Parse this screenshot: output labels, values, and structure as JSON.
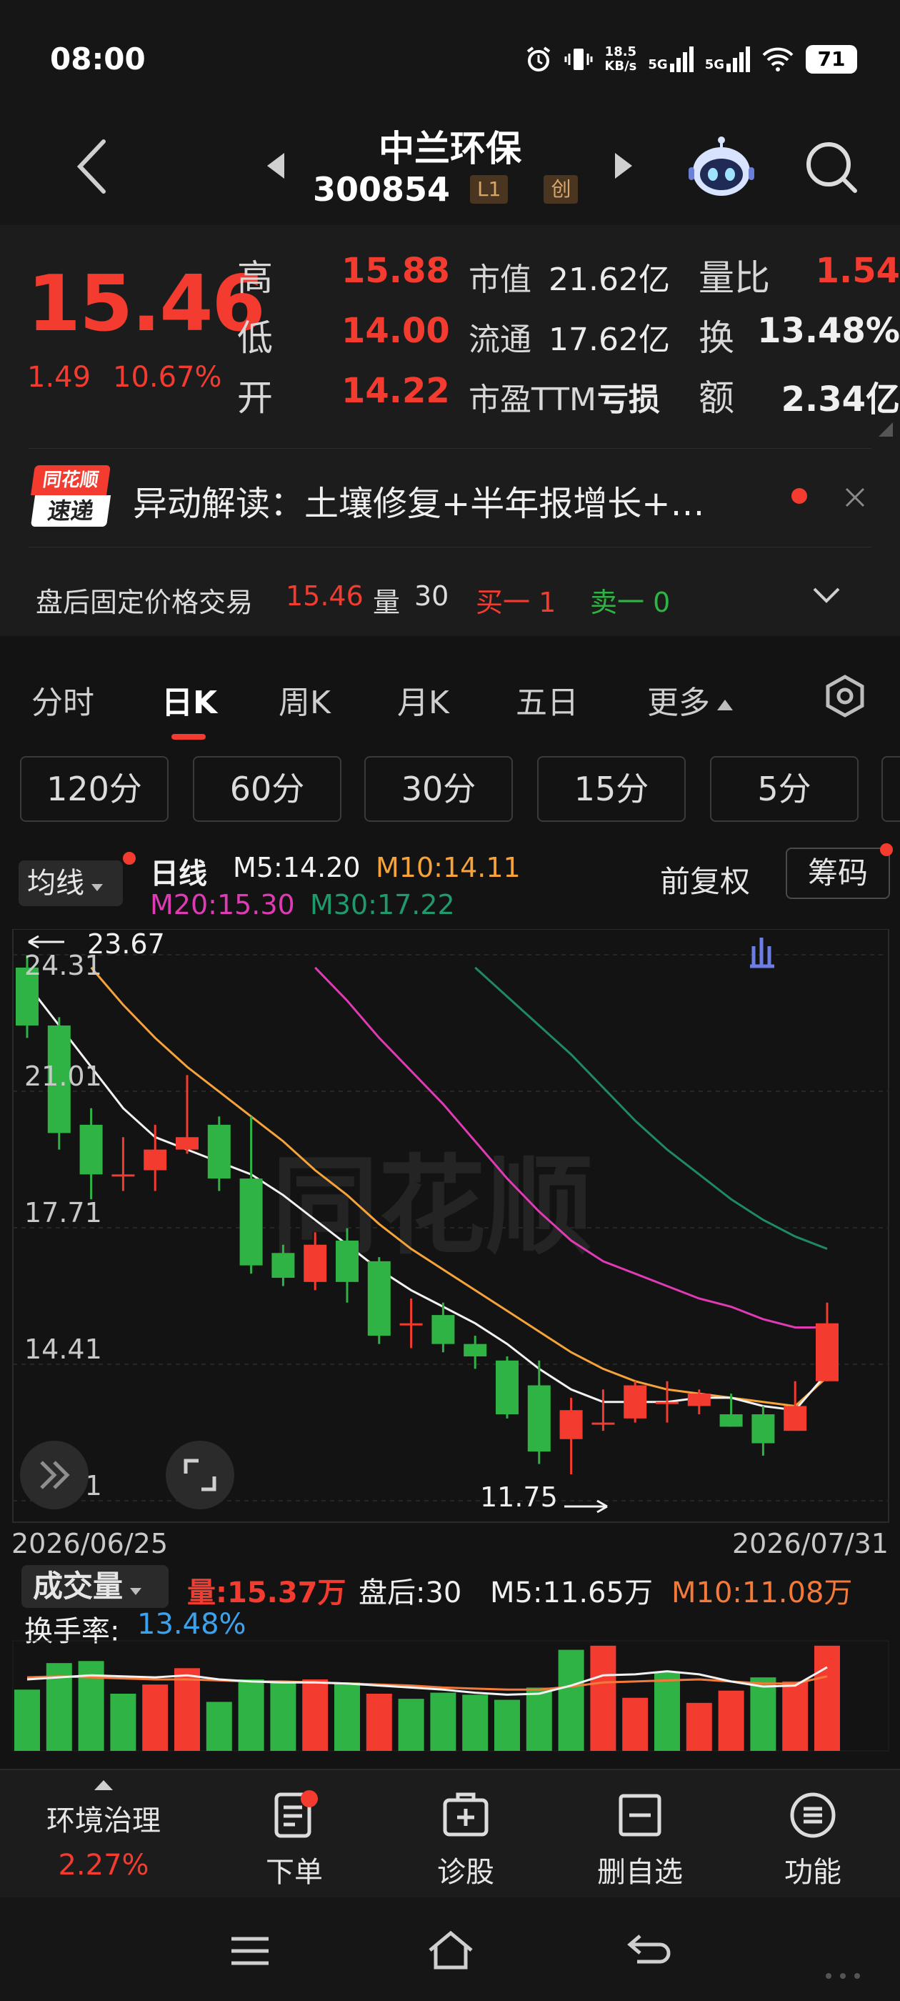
{
  "status": {
    "time": "08:00",
    "net_speed_top": "18.5",
    "net_speed_bottom": "KB/s",
    "signal1": "5G",
    "signal2": "5G",
    "battery": "71"
  },
  "header": {
    "name": "中兰环保",
    "code": "300854",
    "tag_l1": "L1",
    "tag_chuang": "创"
  },
  "quote": {
    "price": "15.46",
    "change_abs": "1.49",
    "change_pct": "10.67%",
    "high_label": "高",
    "high": "15.88",
    "low_label": "低",
    "low": "14.00",
    "open_label": "开",
    "open": "14.22",
    "mcap_label": "市值",
    "mcap": "21.62亿",
    "float_label": "流通",
    "float": "17.62亿",
    "pe_label": "市盈TTM",
    "pe": "亏损",
    "vr_label": "量比",
    "vr": "1.54",
    "turnover_label": "换",
    "turnover": "13.48%",
    "amount_label": "额",
    "amount": "2.34亿"
  },
  "news": {
    "brand_top": "同花顺",
    "brand_bottom": "速递",
    "text": "异动解读：土壤修复+半年报增长+…"
  },
  "after_hours": {
    "label": "盘后固定价格交易",
    "price": "15.46",
    "vol_label": "量",
    "vol": "30",
    "buy": "买一 1",
    "sell": "卖一 0"
  },
  "period_tabs": [
    "分时",
    "日K",
    "周K",
    "月K",
    "五日",
    "更多"
  ],
  "minute_tabs": [
    "120分",
    "60分",
    "30分",
    "15分",
    "5分"
  ],
  "ma": {
    "selector": "均线",
    "daily": "日线",
    "m5": "M5:14.20",
    "m10": "M10:14.11",
    "m20": "M20:15.30",
    "m30": "M30:17.22",
    "restore": "前复权",
    "chips": "筹码"
  },
  "chart_data": {
    "type": "candlestick",
    "y_ticks": [
      "24.31",
      "21.01",
      "17.71",
      "14.41",
      "11.11"
    ],
    "ylim": [
      11.11,
      24.31
    ],
    "high_marker": "23.67",
    "low_marker": "11.75",
    "date_start": "2026/06/25",
    "date_end": "2026/07/31",
    "candles": [
      [
        24.0,
        22.6,
        24.3,
        22.3
      ],
      [
        22.6,
        20.0,
        22.8,
        19.6
      ],
      [
        20.2,
        19.0,
        20.6,
        18.4
      ],
      [
        19.0,
        19.0,
        19.9,
        18.6
      ],
      [
        19.1,
        19.6,
        20.2,
        18.6
      ],
      [
        19.6,
        19.9,
        21.4,
        19.5
      ],
      [
        20.2,
        18.9,
        20.4,
        18.6
      ],
      [
        18.9,
        16.8,
        20.4,
        16.6
      ],
      [
        17.1,
        16.5,
        17.3,
        16.3
      ],
      [
        16.4,
        17.3,
        17.6,
        16.2
      ],
      [
        17.4,
        16.4,
        17.7,
        15.9
      ],
      [
        16.9,
        15.1,
        17.0,
        14.9
      ],
      [
        15.4,
        15.4,
        16.0,
        14.8
      ],
      [
        15.6,
        14.9,
        15.9,
        14.7
      ],
      [
        14.9,
        14.6,
        15.1,
        14.3
      ],
      [
        14.5,
        13.2,
        14.6,
        13.1
      ],
      [
        13.9,
        12.3,
        14.5,
        12.0
      ],
      [
        12.6,
        13.3,
        13.6,
        11.75
      ],
      [
        13.0,
        13.0,
        13.8,
        12.8
      ],
      [
        13.1,
        13.9,
        14.0,
        13.0
      ],
      [
        13.5,
        13.5,
        14.0,
        13.0
      ],
      [
        13.4,
        13.7,
        13.8,
        13.2
      ],
      [
        13.2,
        12.9,
        13.7,
        12.9
      ],
      [
        13.2,
        12.5,
        13.4,
        12.2
      ],
      [
        12.8,
        13.4,
        14.0,
        12.8
      ],
      [
        14.0,
        15.4,
        15.9,
        14.0
      ]
    ],
    "ma5": [
      23.6,
      22.6,
      21.6,
      20.6,
      19.9,
      19.6,
      19.3,
      19.0,
      18.5,
      17.9,
      17.3,
      16.7,
      16.2,
      15.8,
      15.4,
      14.9,
      14.3,
      13.8,
      13.5,
      13.5,
      13.5,
      13.6,
      13.6,
      13.4,
      13.3,
      14.2
    ],
    "ma10": [
      null,
      null,
      24.0,
      23.1,
      22.3,
      21.6,
      21.0,
      20.4,
      19.8,
      19.1,
      18.5,
      17.8,
      17.2,
      16.7,
      16.2,
      15.7,
      15.2,
      14.7,
      14.3,
      14.0,
      13.8,
      13.7,
      13.6,
      13.5,
      13.4,
      14.1
    ],
    "ma20": [
      null,
      null,
      null,
      null,
      null,
      null,
      null,
      null,
      null,
      24.0,
      23.2,
      22.3,
      21.5,
      20.7,
      19.8,
      18.9,
      18.1,
      17.4,
      16.9,
      16.6,
      16.3,
      16.0,
      15.8,
      15.5,
      15.3,
      15.3
    ],
    "ma30": [
      null,
      null,
      null,
      null,
      null,
      null,
      null,
      null,
      null,
      null,
      null,
      null,
      null,
      null,
      24.0,
      23.3,
      22.6,
      21.9,
      21.1,
      20.3,
      19.6,
      19.0,
      18.4,
      17.9,
      17.5,
      17.2
    ]
  },
  "volume": {
    "selector": "成交量",
    "vol": "量:15.37万",
    "after": "盘后:30",
    "m5": "M5:11.65万",
    "m10": "M10:11.08万",
    "turnover_label": "换手率:",
    "turnover": "13.48%",
    "values": [
      6.0,
      8.6,
      8.8,
      5.6,
      6.5,
      8.1,
      4.8,
      7.0,
      6.8,
      7.0,
      6.7,
      5.6,
      5.1,
      5.7,
      5.5,
      5.0,
      6.2,
      9.9,
      10.3,
      5.2,
      7.7,
      4.7,
      5.9,
      7.2,
      6.8,
      10.3
    ],
    "up": [
      false,
      false,
      false,
      false,
      true,
      true,
      false,
      false,
      false,
      true,
      false,
      true,
      false,
      false,
      false,
      false,
      false,
      false,
      true,
      true,
      false,
      true,
      true,
      false,
      true,
      true
    ],
    "ma5": [
      7.0,
      7.2,
      7.4,
      7.3,
      7.2,
      7.4,
      7.0,
      6.8,
      6.7,
      6.7,
      6.6,
      6.4,
      6.2,
      6.0,
      5.7,
      5.5,
      5.6,
      6.4,
      7.4,
      7.5,
      7.8,
      7.5,
      6.8,
      6.3,
      6.4,
      8.2
    ],
    "ma10": [
      7.2,
      7.3,
      7.2,
      7.1,
      7.0,
      7.0,
      6.9,
      6.8,
      6.8,
      6.7,
      6.6,
      6.5,
      6.4,
      6.2,
      6.1,
      6.0,
      6.0,
      6.3,
      6.7,
      6.8,
      6.9,
      7.0,
      6.8,
      6.6,
      6.6,
      7.3
    ]
  },
  "bottom_nav": {
    "sector": "环境治理",
    "sector_pct": "2.27%",
    "order": "下单",
    "diagnose": "诊股",
    "remove": "删自选",
    "function": "功能"
  },
  "colors": {
    "up": "#f33b2f",
    "down": "#2fb344",
    "ma5": "#f2f2f2",
    "ma10": "#f5a33a",
    "ma20": "#e03bb5",
    "ma30": "#1f8a62"
  }
}
